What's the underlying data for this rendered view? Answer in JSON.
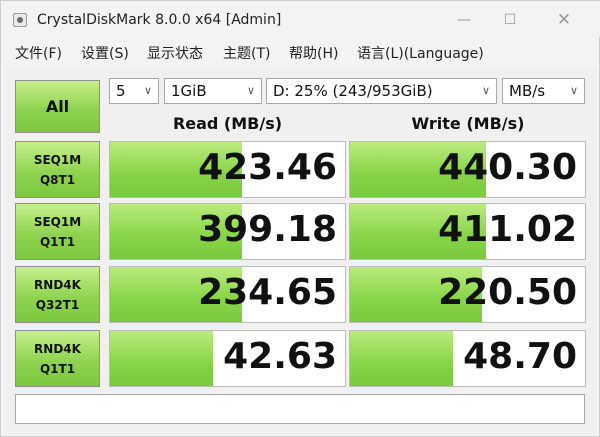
{
  "window": {
    "title": "CrystalDiskMark 8.0.0 x64 [Admin]"
  },
  "titlebar": {
    "minimize": "—",
    "maximize": "☐",
    "close": "✕"
  },
  "menu": [
    "文件(F)",
    "设置(S)",
    "显示状态",
    "主题(T)",
    "帮助(H)",
    "语言(L)(Language)"
  ],
  "controls": {
    "all_label": "All",
    "test_count": "5",
    "test_size": "1GiB",
    "drive": "D: 25% (243/953GiB)",
    "unit": "MB/s"
  },
  "columns": {
    "read": "Read (MB/s)",
    "write": "Write (MB/s)"
  },
  "rows": [
    {
      "line1": "SEQ1M",
      "line2": "Q8T1",
      "read": "423.46",
      "write": "440.30",
      "read_fill": 0.56,
      "write_fill": 0.58
    },
    {
      "line1": "SEQ1M",
      "line2": "Q1T1",
      "read": "399.18",
      "write": "411.02",
      "read_fill": 0.56,
      "write_fill": 0.58
    },
    {
      "line1": "RND4K",
      "line2": "Q32T1",
      "read": "234.65",
      "write": "220.50",
      "read_fill": 0.56,
      "write_fill": 0.56
    },
    {
      "line1": "RND4K",
      "line2": "Q1T1",
      "read": "42.63",
      "write": "48.70",
      "read_fill": 0.44,
      "write_fill": 0.44
    }
  ],
  "comment": ""
}
